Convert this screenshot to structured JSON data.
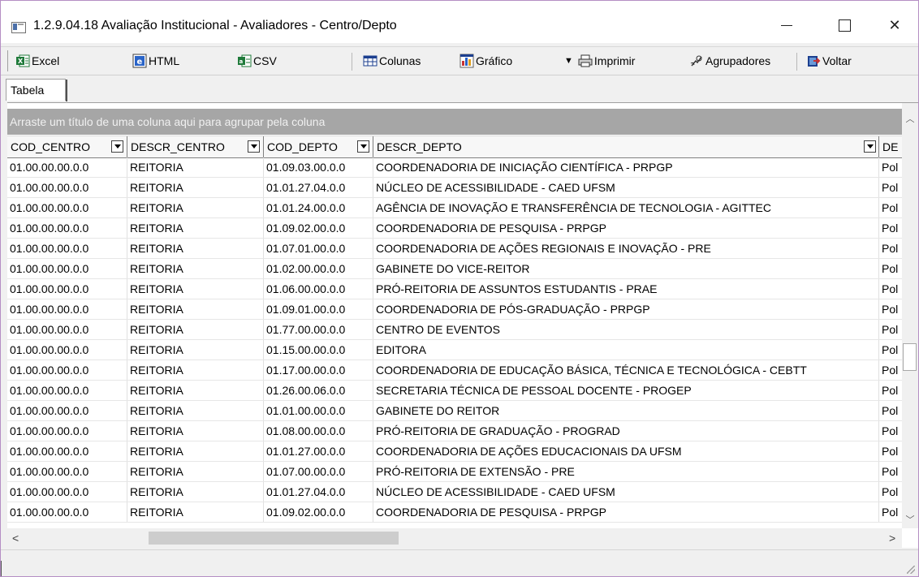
{
  "window": {
    "title": "1.2.9.04.18 Avaliação Institucional - Avaliadores - Centro/Depto",
    "minimize": "—",
    "close": "✕"
  },
  "toolbar": {
    "excel": "Excel",
    "html": "HTML",
    "csv": "CSV",
    "colunas": "Colunas",
    "grafico": "Gráfico",
    "imprimir": "Imprimir",
    "agrupadores": "Agrupadores",
    "voltar": "Voltar"
  },
  "tabs": [
    "Tabela"
  ],
  "grid": {
    "group_hint": "Arraste um título de uma coluna aqui para agrupar pela coluna",
    "columns": [
      "COD_CENTRO",
      "DESCR_CENTRO",
      "COD_DEPTO",
      "DESCR_DEPTO",
      "DE"
    ],
    "rows": [
      [
        "01.00.00.00.0.0",
        "REITORIA",
        "01.09.03.00.0.0",
        "COORDENADORIA DE INICIAÇÃO CIENTÍFICA - PRPGP",
        "Pol"
      ],
      [
        "01.00.00.00.0.0",
        "REITORIA",
        "01.01.27.04.0.0",
        "NÚCLEO DE ACESSIBILIDADE - CAED UFSM",
        "Pol"
      ],
      [
        "01.00.00.00.0.0",
        "REITORIA",
        "01.01.24.00.0.0",
        "AGÊNCIA DE INOVAÇÃO E TRANSFERÊNCIA DE TECNOLOGIA - AGITTEC",
        "Pol"
      ],
      [
        "01.00.00.00.0.0",
        "REITORIA",
        "01.09.02.00.0.0",
        "COORDENADORIA DE PESQUISA - PRPGP",
        "Pol"
      ],
      [
        "01.00.00.00.0.0",
        "REITORIA",
        "01.07.01.00.0.0",
        "COORDENADORIA DE AÇÕES REGIONAIS E INOVAÇÃO - PRE",
        "Pol"
      ],
      [
        "01.00.00.00.0.0",
        "REITORIA",
        "01.02.00.00.0.0",
        "GABINETE DO VICE-REITOR",
        "Pol"
      ],
      [
        "01.00.00.00.0.0",
        "REITORIA",
        "01.06.00.00.0.0",
        "PRÓ-REITORIA DE ASSUNTOS ESTUDANTIS - PRAE",
        "Pol"
      ],
      [
        "01.00.00.00.0.0",
        "REITORIA",
        "01.09.01.00.0.0",
        "COORDENADORIA DE PÓS-GRADUAÇÃO - PRPGP",
        "Pol"
      ],
      [
        "01.00.00.00.0.0",
        "REITORIA",
        "01.77.00.00.0.0",
        "CENTRO DE EVENTOS",
        "Pol"
      ],
      [
        "01.00.00.00.0.0",
        "REITORIA",
        "01.15.00.00.0.0",
        "EDITORA",
        "Pol"
      ],
      [
        "01.00.00.00.0.0",
        "REITORIA",
        "01.17.00.00.0.0",
        "COORDENADORIA DE EDUCAÇÃO BÁSICA, TÉCNICA E TECNOLÓGICA - CEBTT",
        "Pol"
      ],
      [
        "01.00.00.00.0.0",
        "REITORIA",
        "01.26.00.06.0.0",
        "SECRETARIA TÉCNICA DE PESSOAL DOCENTE - PROGEP",
        "Pol"
      ],
      [
        "01.00.00.00.0.0",
        "REITORIA",
        "01.01.00.00.0.0",
        "GABINETE DO REITOR",
        "Pol"
      ],
      [
        "01.00.00.00.0.0",
        "REITORIA",
        "01.08.00.00.0.0",
        "PRÓ-REITORIA DE GRADUAÇÃO - PROGRAD",
        "Pol"
      ],
      [
        "01.00.00.00.0.0",
        "REITORIA",
        "01.01.27.00.0.0",
        "COORDENADORIA DE AÇÕES EDUCACIONAIS DA UFSM",
        "Pol"
      ],
      [
        "01.00.00.00.0.0",
        "REITORIA",
        "01.07.00.00.0.0",
        "PRÓ-REITORIA DE EXTENSÃO - PRE",
        "Pol"
      ],
      [
        "01.00.00.00.0.0",
        "REITORIA",
        "01.01.27.04.0.0",
        "NÚCLEO DE ACESSIBILIDADE - CAED UFSM",
        "Pol"
      ],
      [
        "01.00.00.00.0.0",
        "REITORIA",
        "01.09.02.00.0.0",
        "COORDENADORIA DE PESQUISA - PRPGP",
        "Pol"
      ]
    ]
  },
  "colors": {
    "group_panel": "#a6a6a6",
    "excel_green": "#1f7a3a",
    "html_blue": "#2a64c8"
  }
}
